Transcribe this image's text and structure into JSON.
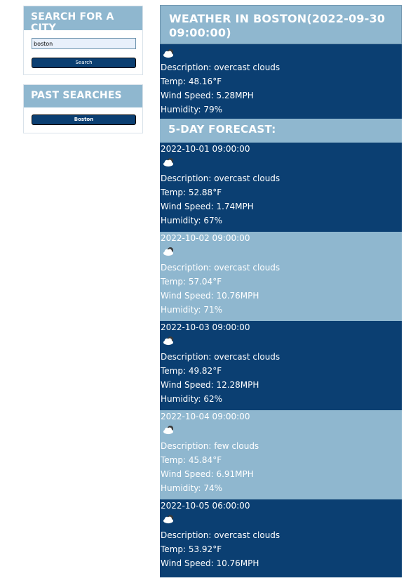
{
  "search": {
    "title": "SEARCH FOR A CITY",
    "input_value": "boston",
    "button_label": "Search"
  },
  "past": {
    "title": "PAST SEARCHES",
    "items": [
      "Boston"
    ]
  },
  "current": {
    "title": "WEATHER IN BOSTON(2022-09-30 09:00:00)",
    "icon": "cloud-icon",
    "description": "Description: overcast clouds",
    "temp": "Temp: 48.16°F",
    "wind": "Wind Speed: 5.28MPH",
    "humidity": "Humidity: 79%"
  },
  "forecast": {
    "title": "5-DAY FORECAST:",
    "days": [
      {
        "date": "2022-10-01 09:00:00",
        "icon": "cloud-icon",
        "description": "Description: overcast clouds",
        "temp": "Temp: 52.88°F",
        "wind": "Wind Speed: 1.74MPH",
        "humidity": "Humidity: 67%"
      },
      {
        "date": "2022-10-02 09:00:00",
        "icon": "cloud-icon",
        "description": "Description: overcast clouds",
        "temp": "Temp: 57.04°F",
        "wind": "Wind Speed: 10.76MPH",
        "humidity": "Humidity: 71%"
      },
      {
        "date": "2022-10-03 09:00:00",
        "icon": "cloud-icon",
        "description": "Description: overcast clouds",
        "temp": "Temp: 49.82°F",
        "wind": "Wind Speed: 12.28MPH",
        "humidity": "Humidity: 62%"
      },
      {
        "date": "2022-10-04 09:00:00",
        "icon": "cloud-icon",
        "description": "Description: few clouds",
        "temp": "Temp: 45.84°F",
        "wind": "Wind Speed: 6.91MPH",
        "humidity": "Humidity: 74%"
      },
      {
        "date": "2022-10-05 06:00:00",
        "icon": "cloud-icon",
        "description": "Description: overcast clouds",
        "temp": "Temp: 53.92°F",
        "wind": "Wind Speed: 10.76MPH"
      }
    ]
  },
  "colors": {
    "dark_blue": "#0b3f72",
    "light_blue": "#8fb7cf"
  }
}
